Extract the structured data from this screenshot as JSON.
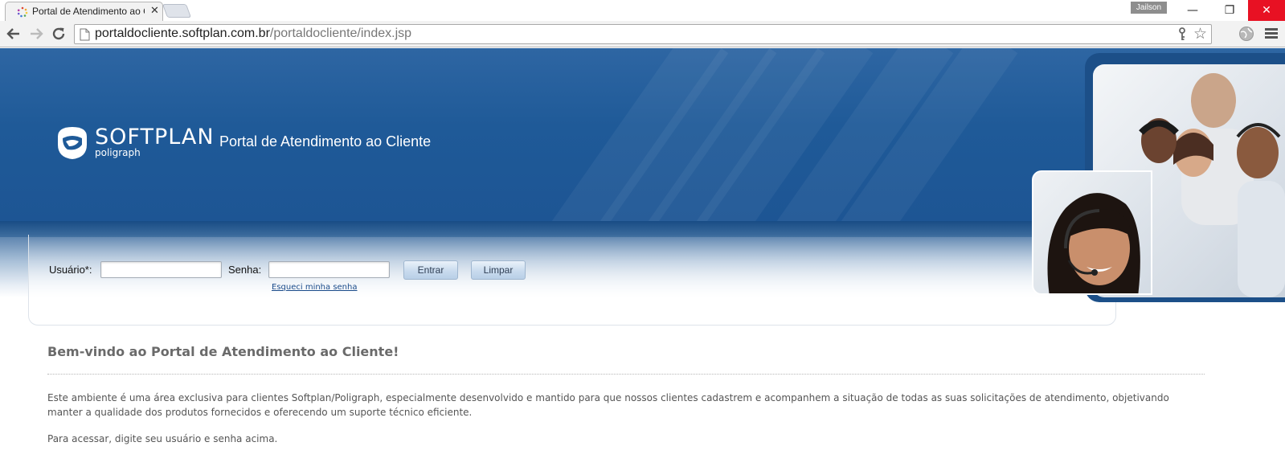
{
  "browser": {
    "tab_title": "Portal de Atendimento ao Cliente",
    "tab_close": "✕",
    "user_name": "Jailson",
    "url_host": "portaldocliente.softplan.com.br",
    "url_path": "/portaldocliente/index.jsp",
    "star_glyph": "☆",
    "min_glyph": "—",
    "max_glyph": "❐",
    "close_glyph": "✕",
    "colors": {
      "close_button": "#e81123",
      "user_badge": "#8e8e8e"
    }
  },
  "header": {
    "logo_text": "SOFTPLAN",
    "logo_sub": "poligraph",
    "portal_title": "Portal de Atendimento ao Cliente",
    "colors": {
      "banner": "#1f5a98"
    }
  },
  "login": {
    "user_label": "Usuário*:",
    "user_value": "",
    "password_label": "Senha:",
    "password_value": "",
    "enter_button": "Entrar",
    "clear_button": "Limpar",
    "forgot_link": "Esqueci minha senha"
  },
  "content": {
    "welcome_title": "Bem-vindo ao Portal de Atendimento ao Cliente!",
    "intro": "Este ambiente é uma área exclusiva para clientes Softplan/Poligraph, especialmente desenvolvido e mantido para que nossos clientes cadastrem e acompanhem a situação de todas as suas solicitações de atendimento, objetivando manter a qualidade dos produtos fornecidos e oferecendo um suporte técnico eficiente.",
    "access_hint": "Para acessar, digite seu usuário e senha acima."
  }
}
